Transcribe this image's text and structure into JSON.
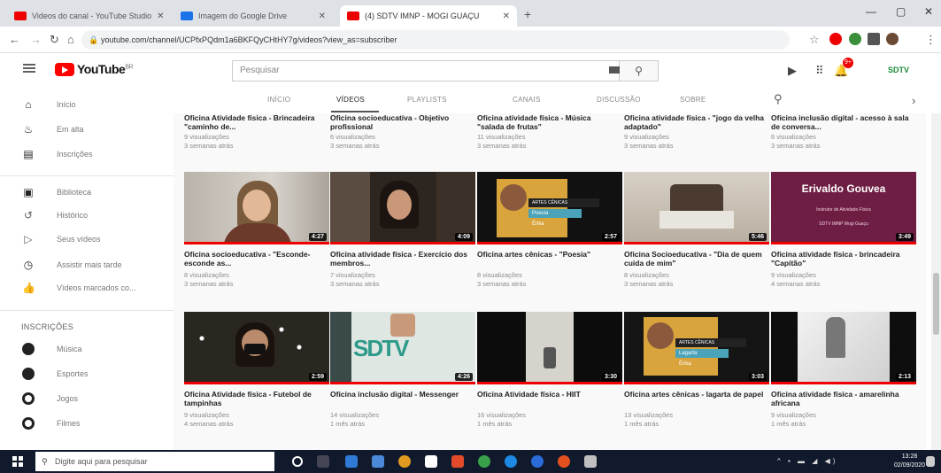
{
  "browser": {
    "tabs": [
      {
        "label": "Videos do canal - YouTube Studio"
      },
      {
        "label": "Imagem do Google Drive"
      },
      {
        "label": "(4) SDTV IMNP - MOGI GUAÇU"
      }
    ],
    "url": "youtube.com/channel/UCPfxPQdm1a6BKFQyCHtHY7g/videos?view_as=subscriber"
  },
  "header": {
    "logo_text": "YouTube",
    "logo_suffix": "BR",
    "search_placeholder": "Pesquisar",
    "notification_count": "9+",
    "channel_badge": "SDTV",
    "icons": {
      "menu": "hamburger-icon",
      "search": "search-icon",
      "create": "video-camera-icon",
      "apps": "apps-grid-icon",
      "notifications": "bell-icon"
    }
  },
  "sidebar": {
    "main": [
      {
        "label": "Início",
        "icon": "home-icon"
      },
      {
        "label": "Em alta",
        "icon": "flame-icon"
      },
      {
        "label": "Inscrições",
        "icon": "subscriptions-icon"
      }
    ],
    "library": [
      {
        "label": "Biblioteca",
        "icon": "library-icon"
      },
      {
        "label": "Histórico",
        "icon": "history-icon"
      },
      {
        "label": "Seus vídeos",
        "icon": "your-videos-icon"
      },
      {
        "label": "Assistir mais tarde",
        "icon": "clock-icon"
      },
      {
        "label": "Vídeos marcados co...",
        "icon": "thumb-up-icon"
      }
    ],
    "subs_heading": "INSCRIÇÕES",
    "subs": [
      {
        "label": "Música"
      },
      {
        "label": "Esportes"
      },
      {
        "label": "Jogos"
      },
      {
        "label": "Filmes"
      }
    ]
  },
  "channel_tabs": [
    "INÍCIO",
    "VÍDEOS",
    "PLAYLISTS",
    "CANAIS",
    "DISCUSSÃO",
    "SOBRE"
  ],
  "videos": [
    {
      "title": "Oficina Atividade física - Brincadeira \"caminho de...",
      "views": "9 visualizações",
      "age": "3 semanas atrás"
    },
    {
      "title": "Oficina socioeducativa - Objetivo profissional",
      "views": "6 visualizações",
      "age": "3 semanas atrás"
    },
    {
      "title": "Oficina atividade física - Música \"salada de frutas\"",
      "views": "11 visualizações",
      "age": "3 semanas atrás"
    },
    {
      "title": "Oficina atividade física - \"jogo da velha adaptado\"",
      "views": "9 visualizações",
      "age": "3 semanas atrás"
    },
    {
      "title": "Oficina inclusão digital - acesso à sala de conversa...",
      "views": "6 visualizações",
      "age": "3 semanas atrás"
    },
    {
      "title": "Oficina socioeducativa - \"Esconde-esconde as...",
      "views": "8 visualizações",
      "age": "3 semanas atrás",
      "duration": "4:27"
    },
    {
      "title": "Oficina atividade física - Exercício dos membros...",
      "views": "7 visualizações",
      "age": "3 semanas atrás",
      "duration": "4:09"
    },
    {
      "title": "Oficina artes cênicas - \"Poesia\"",
      "views": "8 visualizações",
      "age": "3 semanas atrás",
      "duration": "2:57",
      "overlay": [
        "ARTES CÊNICAS",
        "Poesia",
        "Érika"
      ]
    },
    {
      "title": "Oficina Socioeducativa - \"Dia de quem cuida de mim\"",
      "views": "8 visualizações",
      "age": "3 semanas atrás",
      "duration": "5:46"
    },
    {
      "title": "Oficina atividade física - brincadeira \"Capitão\"",
      "views": "9 visualizações",
      "age": "4 semanas atrás",
      "duration": "3:49",
      "overlay": [
        "Erivaldo Gouvea",
        "Instrutor de Atividade Física",
        "SDTV IMNP Mogi Guaçu"
      ]
    },
    {
      "title": "Oficina Atividade física - Futebol de tampinhas",
      "views": "9 visualizações",
      "age": "4 semanas atrás",
      "duration": "2:59"
    },
    {
      "title": "Oficina inclusão digital - Messenger",
      "views": "14 visualizações",
      "age": "1 mês atrás",
      "duration": "4:26"
    },
    {
      "title": "Oficina Atividade física - HIIT",
      "views": "16 visualizações",
      "age": "1 mês atrás",
      "duration": "3:30"
    },
    {
      "title": "Oficina artes cênicas - lagarta de papel",
      "views": "13 visualizações",
      "age": "1 mês atrás",
      "duration": "3:03",
      "overlay": [
        "ARTES CÊNICAS",
        "Lagarta",
        "Érika"
      ]
    },
    {
      "title": "Oficina atividade física - amarelinha africana",
      "views": "9 visualizações",
      "age": "1 mês atrás",
      "duration": "2:13"
    }
  ],
  "taskbar": {
    "search_placeholder": "Digite aqui para pesquisar",
    "time": "13:28",
    "date": "02/09/2020"
  }
}
